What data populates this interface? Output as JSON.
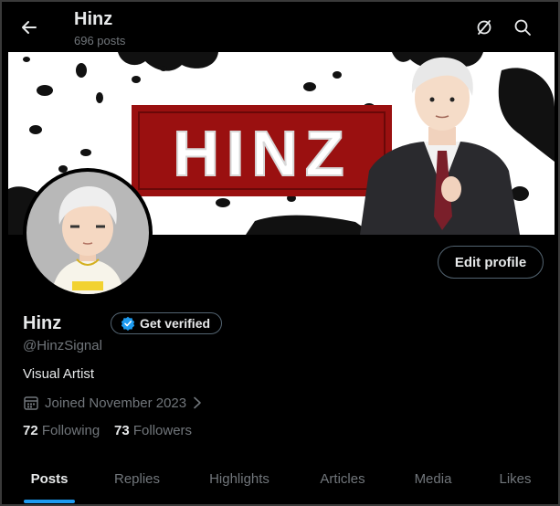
{
  "header": {
    "title": "Hinz",
    "post_count": "696 posts"
  },
  "banner": {
    "logo_text": "HINZ"
  },
  "profile": {
    "edit_label": "Edit profile",
    "name": "Hinz",
    "verify_label": "Get verified",
    "handle": "@HinzSignal",
    "bio": "Visual Artist",
    "joined": "Joined November 2023",
    "following_count": "72",
    "following_label": "Following",
    "followers_count": "73",
    "followers_label": "Followers"
  },
  "tabs": [
    {
      "label": "Posts"
    },
    {
      "label": "Replies"
    },
    {
      "label": "Highlights"
    },
    {
      "label": "Articles"
    },
    {
      "label": "Media"
    },
    {
      "label": "Likes"
    }
  ],
  "colors": {
    "accent": "#1d9bf0",
    "banner_red": "#9a1010",
    "background": "#000000"
  },
  "icons": [
    "arrow-left-icon",
    "grok-icon",
    "search-icon",
    "verified-badge-icon",
    "calendar-icon",
    "chevron-right-icon"
  ]
}
